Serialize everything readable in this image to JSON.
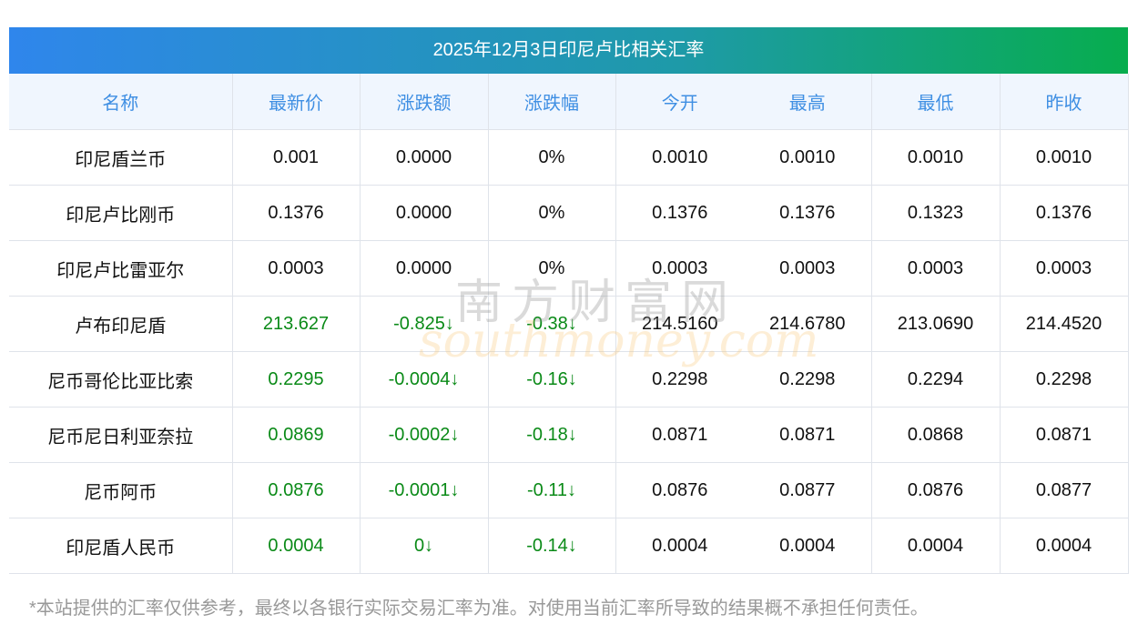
{
  "title": "2025年12月3日印尼卢比相关汇率",
  "headers": [
    "名称",
    "最新价",
    "涨跌额",
    "涨跌幅",
    "今开",
    "最高",
    "最低",
    "昨收"
  ],
  "rows": [
    {
      "name": "印尼盾兰币",
      "latest": "0.001",
      "change": "0.0000",
      "pct": "0%",
      "open": "0.0010",
      "high": "0.0010",
      "low": "0.0010",
      "prev": "0.0010",
      "down": false
    },
    {
      "name": "印尼卢比刚币",
      "latest": "0.1376",
      "change": "0.0000",
      "pct": "0%",
      "open": "0.1376",
      "high": "0.1376",
      "low": "0.1323",
      "prev": "0.1376",
      "down": false
    },
    {
      "name": "印尼卢比雷亚尔",
      "latest": "0.0003",
      "change": "0.0000",
      "pct": "0%",
      "open": "0.0003",
      "high": "0.0003",
      "low": "0.0003",
      "prev": "0.0003",
      "down": false
    },
    {
      "name": "卢布印尼盾",
      "latest": "213.627",
      "change": "-0.825↓",
      "pct": "-0.38↓",
      "open": "214.5160",
      "high": "214.6780",
      "low": "213.0690",
      "prev": "214.4520",
      "down": true
    },
    {
      "name": "尼币哥伦比亚比索",
      "latest": "0.2295",
      "change": "-0.0004↓",
      "pct": "-0.16↓",
      "open": "0.2298",
      "high": "0.2298",
      "low": "0.2294",
      "prev": "0.2298",
      "down": true
    },
    {
      "name": "尼币尼日利亚奈拉",
      "latest": "0.0869",
      "change": "-0.0002↓",
      "pct": "-0.18↓",
      "open": "0.0871",
      "high": "0.0871",
      "low": "0.0868",
      "prev": "0.0871",
      "down": true
    },
    {
      "name": "尼币阿币",
      "latest": "0.0876",
      "change": "-0.0001↓",
      "pct": "-0.11↓",
      "open": "0.0876",
      "high": "0.0877",
      "low": "0.0876",
      "prev": "0.0877",
      "down": true
    },
    {
      "name": "印尼盾人民币",
      "latest": "0.0004",
      "change": "0↓",
      "pct": "-0.14↓",
      "open": "0.0004",
      "high": "0.0004",
      "low": "0.0004",
      "prev": "0.0004",
      "down": true
    }
  ],
  "watermark": {
    "cn": "南方财富网",
    "en": "southmoney.com"
  },
  "note": "*本站提供的汇率仅供参考，最终以各银行实际交易汇率为准。对使用当前汇率所导致的结果概不承担任何责任。",
  "colors": {
    "header_text": "#3f8fe3",
    "down": "#0a8a17"
  }
}
